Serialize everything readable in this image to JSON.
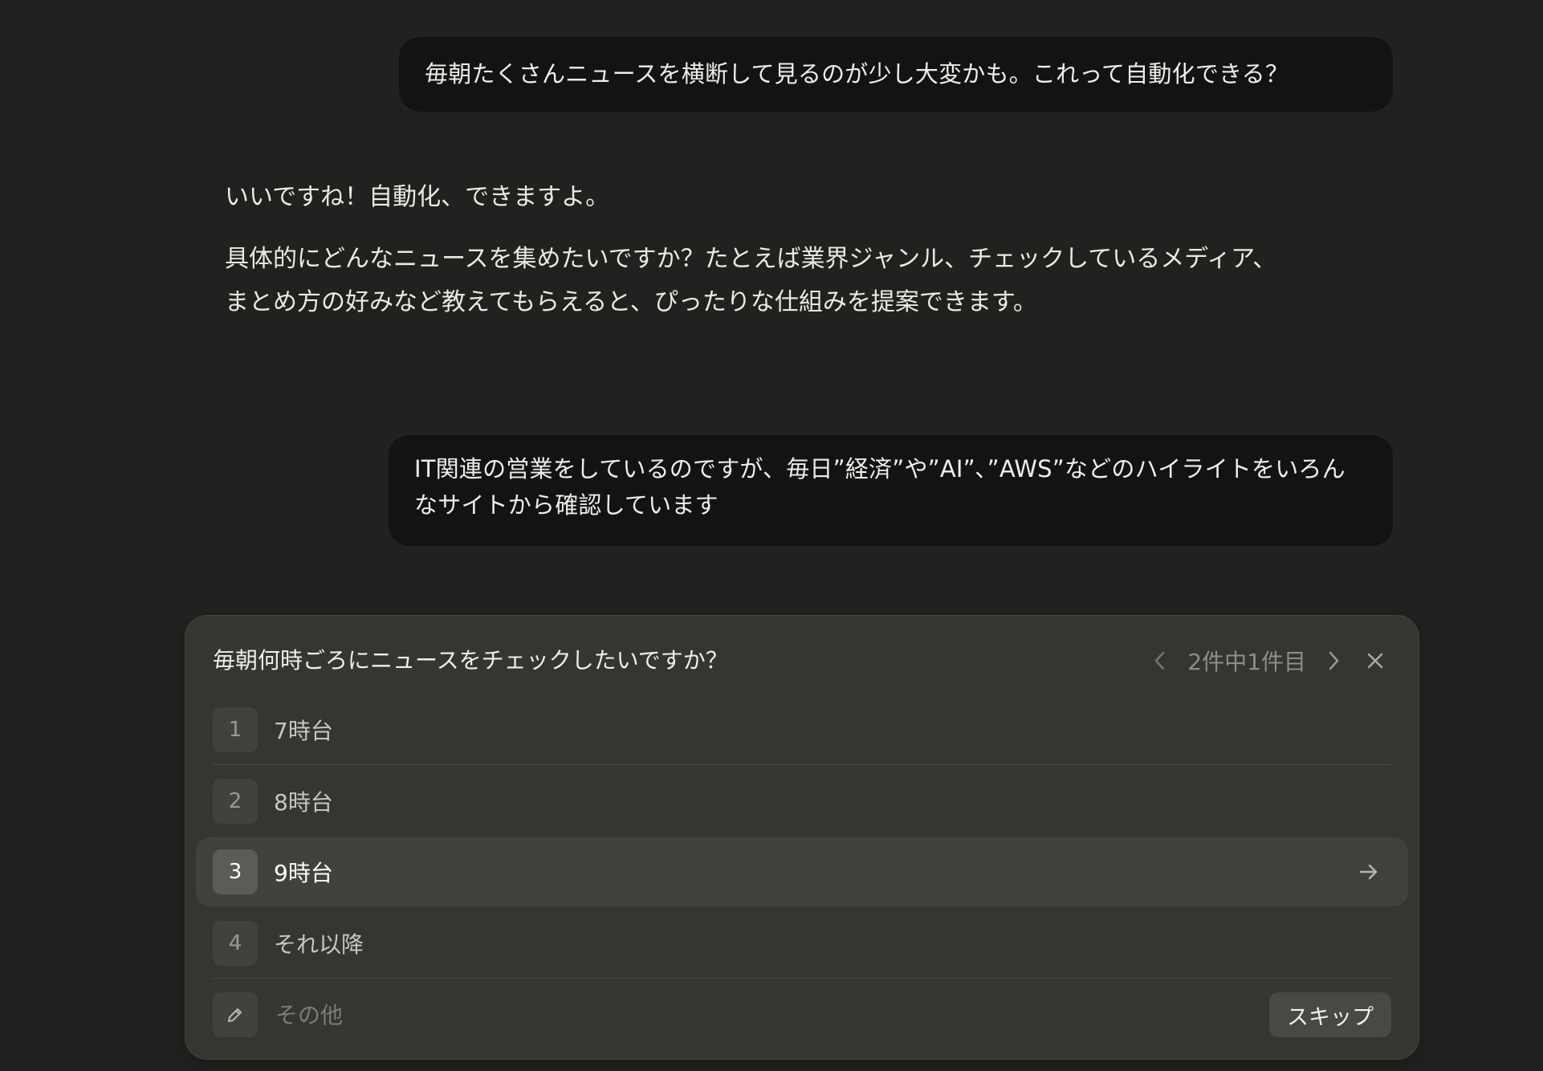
{
  "messages": {
    "user1": "毎朝たくさんニュースを横断して見るのが少し大変かも。これって自動化できる？",
    "assistant_p1": "いいですね！自動化、できますよ。",
    "assistant_p2": "具体的にどんなニュースを集めたいですか？たとえば業界ジャンル、チェックしているメディア、\nまとめ方の好みなど教えてもらえると、ぴったりな仕組みを提案できます。",
    "user2": "IT関連の営業をしているのですが、毎日”経済”や”AI”､”AWS”などのハイライトをいろんなサイトから確認しています"
  },
  "question_card": {
    "title": "毎朝何時ごろにニュースをチェックしたいですか？",
    "pager": "2件中1件目",
    "options": [
      {
        "number": "1",
        "label": "7時台"
      },
      {
        "number": "2",
        "label": "8時台"
      },
      {
        "number": "3",
        "label": "9時台",
        "selected": true
      },
      {
        "number": "4",
        "label": "それ以降"
      }
    ],
    "other_placeholder": "その他",
    "skip_label": "スキップ"
  },
  "icons": {
    "prev": "chevron-left-icon",
    "next": "chevron-right-icon",
    "close": "close-icon",
    "selected_option": "arrow-right-icon",
    "other": "pencil-icon"
  },
  "colors": {
    "background": "#212120",
    "user_bubble": "#131313",
    "card": "#353532",
    "selected_option": "#41413d"
  }
}
